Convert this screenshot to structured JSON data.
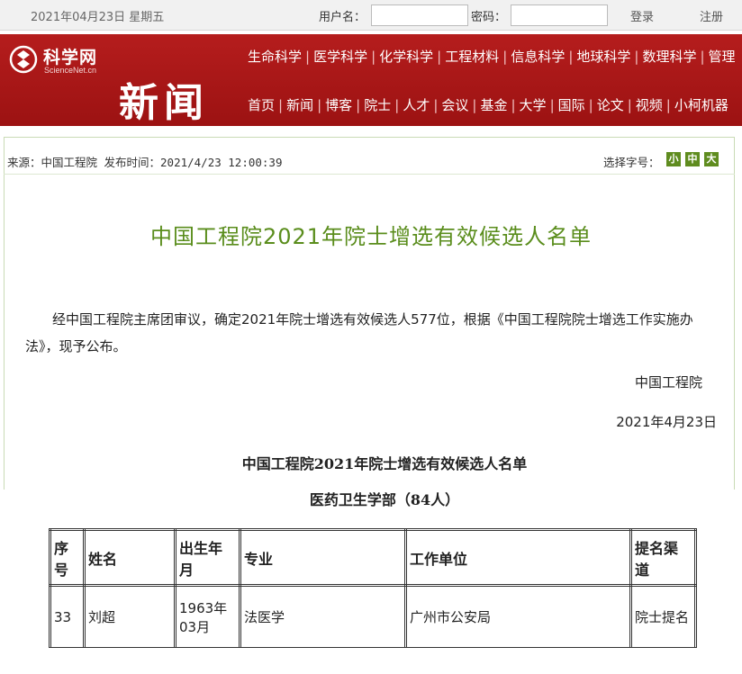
{
  "topbar": {
    "date": "2021年04月23日 星期五",
    "username_label": "用户名：",
    "username_value": "",
    "password_label": "密码：",
    "password_value": "",
    "login": "登录",
    "register": "注册"
  },
  "header": {
    "logo_name": "科学网",
    "logo_sub": "ScienceNet.cn",
    "section": "新闻",
    "nav_row1": [
      "生命科学",
      "医学科学",
      "化学科学",
      "工程材料",
      "信息科学",
      "地球科学",
      "数理科学",
      "管理"
    ],
    "nav_row2": [
      "首页",
      "新闻",
      "博客",
      "院士",
      "人才",
      "会议",
      "基金",
      "大学",
      "国际",
      "论文",
      "视频",
      "小柯机器"
    ]
  },
  "article": {
    "meta": "来源：中国工程院 发布时间：2021/4/23 12:00:39",
    "font_size_label": "选择字号：",
    "font_sizes": [
      "小",
      "中",
      "大"
    ],
    "title": "中国工程院2021年院士增选有效候选人名单",
    "paragraph": "经中国工程院主席团审议，确定2021年院士增选有效候选人577位，根据《中国工程院院士增选工作实施办法》，现予公布。",
    "signature": "中国工程院",
    "date": "2021年4月23日",
    "list_title": "中国工程院2021年院士增选有效候选人名单",
    "division": "医药卫生学部（84人）"
  },
  "table": {
    "headers": [
      "序号",
      "姓名",
      "出生年月",
      "专业",
      "工作单位",
      "提名渠道"
    ],
    "rows": [
      [
        "33",
        "刘超",
        "1963年03月",
        "法医学",
        "广州市公安局",
        "院士提名"
      ]
    ]
  },
  "colors": {
    "header_red": "#a81818",
    "title_green": "#5a8d1c",
    "button_green": "#5f8c1f"
  }
}
